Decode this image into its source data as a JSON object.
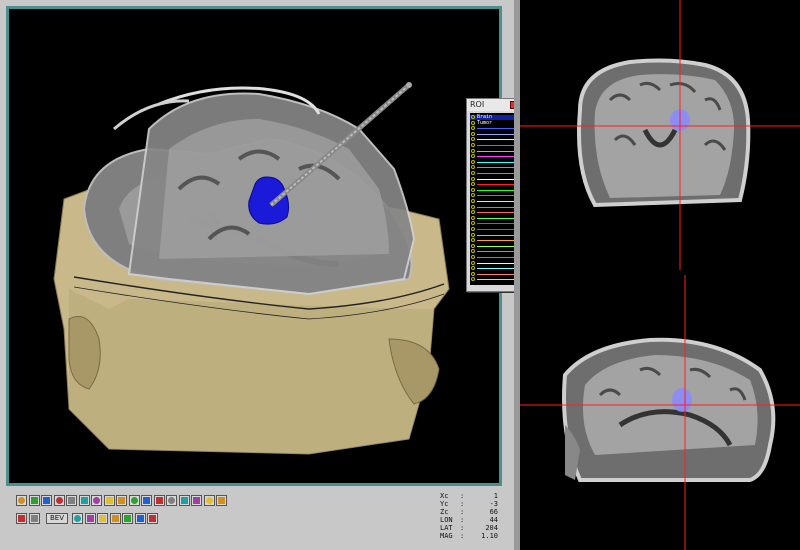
{
  "roi_panel": {
    "title": "ROI",
    "items": [
      {
        "label": "Brain",
        "color": "#2030ff",
        "selected": true
      },
      {
        "label": "Tumor",
        "color": "#20c020"
      },
      {
        "label": "",
        "color": "#4060ff"
      },
      {
        "label": "",
        "color": "#a0a0ff"
      },
      {
        "label": "",
        "color": "#ffff40"
      },
      {
        "label": "",
        "color": "#ff4040"
      },
      {
        "label": "",
        "color": "#40ff40"
      },
      {
        "label": "",
        "color": "#ff40ff"
      },
      {
        "label": "",
        "color": "#40ffff"
      },
      {
        "label": "",
        "color": "#ff8000"
      },
      {
        "label": "",
        "color": "#8080ff"
      },
      {
        "label": "",
        "color": "#ffffff"
      },
      {
        "label": "",
        "color": "#ff2020"
      },
      {
        "label": "",
        "color": "#20ff20"
      },
      {
        "label": "",
        "color": "#c040ff"
      },
      {
        "label": "",
        "color": "#ffff00"
      },
      {
        "label": "",
        "color": "#00c0ff"
      },
      {
        "label": "",
        "color": "#ff6060"
      },
      {
        "label": "",
        "color": "#60ff60"
      },
      {
        "label": "",
        "color": "#6060ff"
      },
      {
        "label": "",
        "color": "#ff00ff"
      },
      {
        "label": "",
        "color": "#00ffff"
      },
      {
        "label": "",
        "color": "#ffa040"
      },
      {
        "label": "",
        "color": "#a0ff40"
      },
      {
        "label": "",
        "color": "#40a0ff"
      },
      {
        "label": "",
        "color": "#ff40a0"
      },
      {
        "label": "",
        "color": "#ffff80"
      },
      {
        "label": "",
        "color": "#80ffff"
      },
      {
        "label": "",
        "color": "#ff8080"
      },
      {
        "label": "",
        "color": "#80ff80"
      }
    ]
  },
  "toolbar": {
    "row1_icons": [
      "rotate-left-icon",
      "rotate-right-icon",
      "curve-icon",
      "rotate-icon",
      "zoom-in-icon",
      "zoom-out-icon",
      "view-grid-icon",
      "lens-icon",
      "cursor-icon",
      "target-icon",
      "circle-icon",
      "no-entry-icon",
      "contrast-icon",
      "arrow-left-icon",
      "arrow-right-icon",
      "monitor-icon",
      "close-view-icon"
    ],
    "row2_icons": [
      "grid-view-icon",
      "slice-view-icon",
      "record-icon",
      "stack-icon",
      "sphere-icon",
      "calendar-icon",
      "table-icon",
      "crosshair-icon",
      "print-icon"
    ],
    "bev_label": "BEV"
  },
  "readout": [
    {
      "label": "Xc",
      "sep": ":",
      "value": "1"
    },
    {
      "label": "Yc",
      "sep": ":",
      "value": "-3"
    },
    {
      "label": "Zc",
      "sep": ":",
      "value": "66"
    },
    {
      "label": "LON",
      "sep": ":",
      "value": "44"
    },
    {
      "label": "LAT",
      "sep": ":",
      "value": "204"
    },
    {
      "label": "MAG",
      "sep": ":",
      "value": "1.10"
    }
  ],
  "colors": {
    "viewport_border": "#4c8f8f",
    "skin": "#c8b88a",
    "tumor": "#1a1ad8",
    "crosshair": "#ff2020"
  }
}
